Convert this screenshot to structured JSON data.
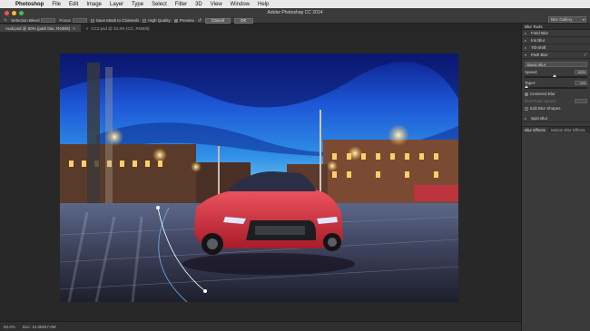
{
  "menubar": {
    "app": "Photoshop",
    "items": [
      "File",
      "Edit",
      "Image",
      "Layer",
      "Type",
      "Select",
      "Filter",
      "3D",
      "View",
      "Window",
      "Help"
    ]
  },
  "window": {
    "title": "Adobe Photoshop CC 2014"
  },
  "options": {
    "selection_bleed": "Selection Bleed",
    "focus": "Focus",
    "save_mask": "Save Mask to Channels",
    "high_quality": "High Quality",
    "preview": "Preview",
    "cancel": "Cancel",
    "ok": "OK",
    "gallery": "Blur Gallery"
  },
  "tabs": [
    {
      "label": "Audi.psd @ 50% (path blur, RGB/8)"
    },
    {
      "label": "CC2.psd @ 33.3% (CC, RGB/8)"
    }
  ],
  "status": {
    "zoom": "50.0%",
    "doc": "Doc: 12.0M/47.0M"
  },
  "panel": {
    "header": "Blur Tools",
    "tools": [
      "Field Blur",
      "Iris Blur",
      "Tilt-Shift",
      "Path Blur",
      "Spin Blur"
    ],
    "path_blur": {
      "type": "Basic Blur",
      "speed_label": "Speed:",
      "speed_value": "50%",
      "taper_label": "Taper:",
      "taper_value": "0%",
      "centered": "Centered Blur",
      "end_point": "End Point Speed:",
      "edit_shapes": "Edit Blur Shapes"
    },
    "effects_tabs": [
      "Blur Effects",
      "Motion Blur Effects"
    ]
  },
  "colors": {
    "accent": "#3a3a3a",
    "sky_top": "#1a3cc0",
    "car": "#d8323c"
  }
}
